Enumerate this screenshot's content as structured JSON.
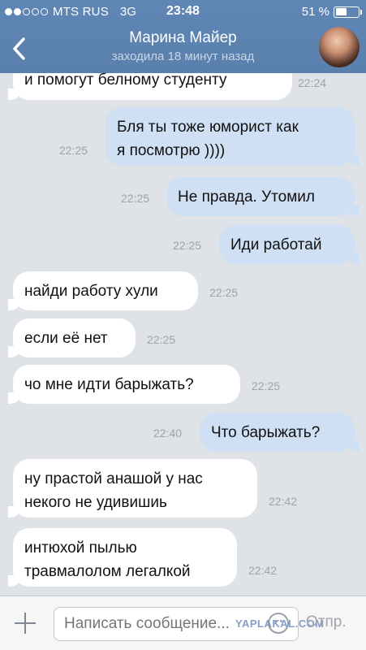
{
  "status_bar": {
    "carrier": "MTS RUS",
    "network": "3G",
    "time": "23:48",
    "battery_text": "51 %",
    "battery_level": 0.51,
    "signal_bars_filled": 2,
    "signal_bars_total": 5
  },
  "header": {
    "title": "Марина Майер",
    "subtitle": "заходила 18 минут назад",
    "back_icon": "chevron-left-icon",
    "accent_color": "#5b82b1"
  },
  "messages": [
    {
      "side": "in",
      "text": "и помогут белному студенту",
      "time": "22:24"
    },
    {
      "side": "out",
      "lines": [
        "Бля ты тоже юморист как",
        "я посмотрю ))))"
      ],
      "time": "22:25"
    },
    {
      "side": "out",
      "text": "Не правда. Утомил",
      "time": "22:25"
    },
    {
      "side": "out",
      "text": "Иди работай",
      "time": "22:25"
    },
    {
      "side": "in",
      "text": "найди работу хули",
      "time": "22:25"
    },
    {
      "side": "in",
      "text": "если её нет",
      "time": "22:25"
    },
    {
      "side": "in",
      "text": "чо мне идти барыжать?",
      "time": "22:25"
    },
    {
      "side": "out",
      "text": "Что барыжать?",
      "time": "22:40"
    },
    {
      "side": "in",
      "lines": [
        "ну прастой анашой у нас",
        "некого не удивишиь"
      ],
      "time": "22:42"
    },
    {
      "side": "in",
      "lines": [
        "интюхой пылью",
        "травмалолом легалкой"
      ],
      "time": "22:42"
    }
  ],
  "input_bar": {
    "placeholder": "Написать сообщение...",
    "send_label": "Отпр.",
    "watermark": "YAPLAKAL.COM"
  }
}
